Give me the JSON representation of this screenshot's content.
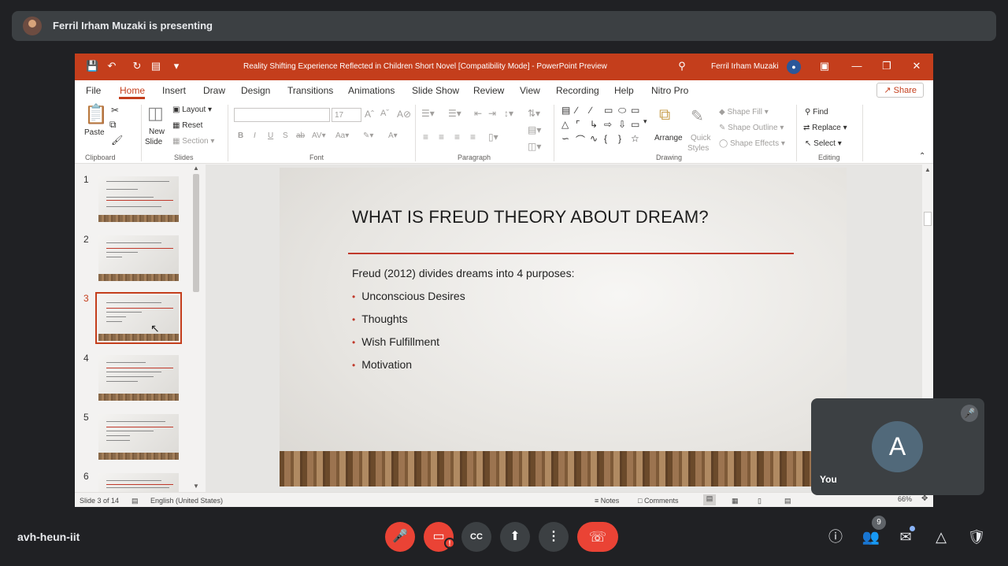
{
  "presenter": {
    "label": "Ferril Irham Muzaki is presenting"
  },
  "ppt": {
    "window_title": "Reality Shifting Experience Reflected in Children Short Novel [Compatibility Mode]  -  PowerPoint Preview",
    "user_name": "Ferril Irham Muzaki",
    "menu": [
      "File",
      "Home",
      "Insert",
      "Draw",
      "Design",
      "Transitions",
      "Animations",
      "Slide Show",
      "Review",
      "View",
      "Recording",
      "Help",
      "Nitro Pro"
    ],
    "share_label": "Share",
    "ribbon": {
      "paste": "Paste",
      "clipboard": "Clipboard",
      "new_slide": "New",
      "new_slide2": "Slide",
      "layout": "Layout",
      "reset": "Reset",
      "section": "Section",
      "slides": "Slides",
      "font_size": "17",
      "font": "Font",
      "paragraph": "Paragraph",
      "arrange": "Arrange",
      "quick_styles": "Quick",
      "quick_styles2": "Styles",
      "shape_fill": "Shape Fill",
      "shape_outline": "Shape Outline",
      "shape_effects": "Shape Effects",
      "drawing": "Drawing",
      "find": "Find",
      "replace": "Replace",
      "select": "Select",
      "editing": "Editing"
    },
    "thumbnails": [
      {
        "num": "1"
      },
      {
        "num": "2"
      },
      {
        "num": "3"
      },
      {
        "num": "4"
      },
      {
        "num": "5"
      },
      {
        "num": "6"
      }
    ],
    "slide": {
      "title": "WHAT IS FREUD THEORY ABOUT DREAM?",
      "intro": "Freud (2012) divides dreams into 4 purposes:",
      "bullets": [
        "Unconscious Desires",
        "Thoughts",
        "Wish Fulfillment",
        "Motivation"
      ]
    },
    "status": {
      "slide_of": "Slide 3 of 14",
      "language": "English (United States)",
      "notes": "Notes",
      "comments": "Comments",
      "zoom": "66%"
    }
  },
  "self_tile": {
    "initial": "A",
    "label": "You"
  },
  "meeting_code": "avh-heun-iit",
  "participants_count": "9",
  "colors": {
    "accent": "#c43e1c",
    "end_call": "#ea4335",
    "meet_bg": "#202124"
  }
}
